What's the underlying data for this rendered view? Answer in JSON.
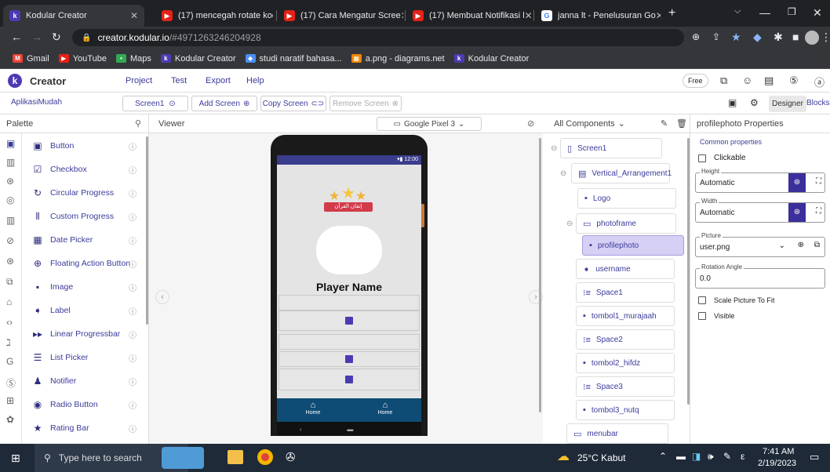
{
  "browser": {
    "tabs": [
      {
        "label": "Kodular Creator",
        "icon": "kodular-icon",
        "active": true
      },
      {
        "label": "(17) mencegah rotate kod",
        "icon": "youtube-icon"
      },
      {
        "label": "(17) Cara Mengatur Scree",
        "icon": "youtube-icon"
      },
      {
        "label": "(17) Membuat Notifikasi l",
        "icon": "youtube-icon"
      },
      {
        "label": "janna lt - Penelusuran Go",
        "icon": "google-icon"
      }
    ],
    "url_domain": "creator.kodular.io",
    "url_path": "/#4971263246204928",
    "bookmarks": [
      "Gmail",
      "YouTube",
      "Maps",
      "Kodular Creator",
      "studi naratif bahasa...",
      "a.png - diagrams.net",
      "Kodular Creator"
    ]
  },
  "app": {
    "brand": "Creator",
    "menu": [
      "Project",
      "Test",
      "Export",
      "Help"
    ],
    "plan": "Free",
    "project_name": "AplikasiMudah",
    "screen": "Screen1",
    "add_screen": "Add Screen",
    "copy_screen": "Copy Screen",
    "remove_screen": "Remove Screen",
    "designer": "Designer",
    "blocks": "Blocks"
  },
  "palette": {
    "title": "Palette",
    "items": [
      "Button",
      "Checkbox",
      "Circular Progress",
      "Custom Progress",
      "Date Picker",
      "Floating Action Button",
      "Image",
      "Label",
      "Linear Progressbar",
      "List Picker",
      "Notifier",
      "Radio Button",
      "Rating Bar"
    ]
  },
  "viewer": {
    "title": "Viewer",
    "device": "Google Pixel 3",
    "status_time": "12:00",
    "banner_text": "إتقان القرآن",
    "player_name": "Player Name",
    "nav": [
      "Home",
      "Home"
    ]
  },
  "components": {
    "title": "All Components",
    "tree": [
      "Screen1",
      "Vertical_Arrangement1",
      "Logo",
      "photoframe",
      "profilephoto",
      "username",
      "Space1",
      "tombol1_murajaah",
      "Space2",
      "tombol2_hifdz",
      "Space3",
      "tombol3_nutq",
      "menubar"
    ]
  },
  "properties": {
    "title": "profilephoto Properties",
    "section": "Common properties",
    "clickable": "Clickable",
    "height_label": "Height",
    "height": "Automatic",
    "width_label": "Width",
    "width": "Automatic",
    "picture_label": "Picture",
    "picture": "user.png",
    "rotation_label": "Rotation Angle",
    "rotation": "0.0",
    "scale": "Scale Picture To Fit",
    "visible": "Visible"
  },
  "taskbar": {
    "search": "Type here to search",
    "weather": "25°C  Kabut",
    "time": "7:41 AM",
    "date": "2/19/2023"
  }
}
